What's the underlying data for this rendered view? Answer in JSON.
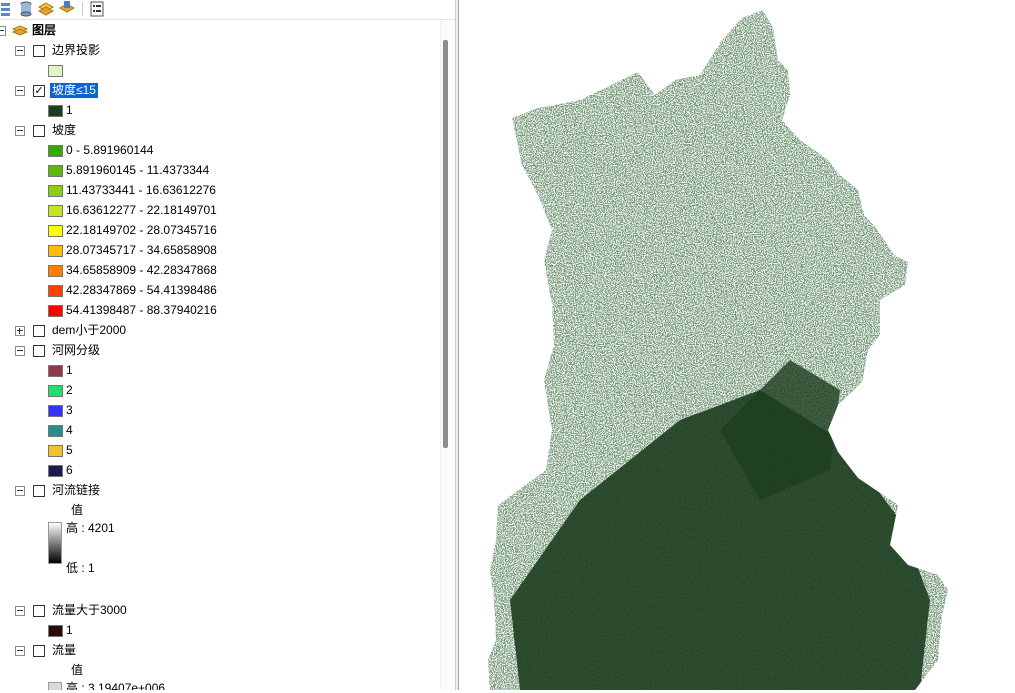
{
  "toc": {
    "root_label": "图层",
    "layers": [
      {
        "label": "边界投影",
        "checked": false,
        "legend": [
          {
            "label": "",
            "color": "#dff5c8"
          }
        ]
      },
      {
        "label": "坡度≤15",
        "checked": true,
        "selected": true,
        "legend": [
          {
            "label": "1",
            "color": "#1d3d1e"
          }
        ]
      },
      {
        "label": "坡度",
        "checked": false,
        "legend": [
          {
            "label": "0 - 5.891960144",
            "color": "#38a800"
          },
          {
            "label": "5.891960145 - 11.4373344",
            "color": "#5cb80a"
          },
          {
            "label": "11.43733441 - 16.63612276",
            "color": "#8ccf0f"
          },
          {
            "label": "16.63612277 - 22.18149701",
            "color": "#c6e51c"
          },
          {
            "label": "22.18149702 - 28.07345716",
            "color": "#ffff00"
          },
          {
            "label": "28.07345717 - 34.65858908",
            "color": "#ffbf00"
          },
          {
            "label": "34.65858909 - 42.28347868",
            "color": "#ff8000"
          },
          {
            "label": "42.28347869 - 54.41398486",
            "color": "#ff4000"
          },
          {
            "label": "54.41398487 - 88.37940216",
            "color": "#ff0000"
          }
        ]
      },
      {
        "label": "dem小于2000",
        "checked": false,
        "collapsed": true
      },
      {
        "label": "河网分级",
        "checked": false,
        "legend": [
          {
            "label": "1",
            "color": "#8c3a4c"
          },
          {
            "label": "2",
            "color": "#1fe06a"
          },
          {
            "label": "3",
            "color": "#3333ff"
          },
          {
            "label": "4",
            "color": "#2a8c8c"
          },
          {
            "label": "5",
            "color": "#f2c12e"
          },
          {
            "label": "6",
            "color": "#1a1a4d"
          }
        ]
      },
      {
        "label": "河流链接",
        "checked": false,
        "value_header": "值",
        "high": "高 : 4201",
        "low": "低 : 1"
      },
      {
        "label": "流量大于3000",
        "checked": false,
        "legend": [
          {
            "label": "1",
            "color": "#2a0a0a"
          }
        ]
      },
      {
        "label": "流量",
        "checked": false,
        "value_header": "值",
        "high": "高 : 3.19407e+006"
      }
    ]
  },
  "colors": {
    "selection": "#0a64d2",
    "map_fill": "#1d3d1e"
  },
  "icons": {
    "toolbar": [
      "list-by-drawing-order-icon",
      "list-by-source-icon",
      "list-by-visibility-icon",
      "list-by-selection-icon",
      "options-icon"
    ]
  }
}
